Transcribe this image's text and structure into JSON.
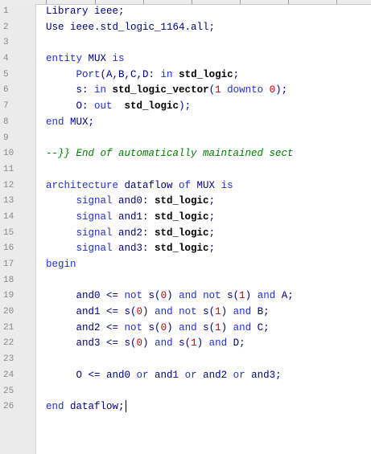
{
  "editor": {
    "lines": [
      {
        "n": "1",
        "tokens": [
          {
            "t": "Library ieee;",
            "c": "id"
          }
        ]
      },
      {
        "n": "2",
        "tokens": [
          {
            "t": "Use ieee.std_logic_1164.all;",
            "c": "id"
          }
        ]
      },
      {
        "n": "3",
        "tokens": []
      },
      {
        "n": "4",
        "tokens": [
          {
            "t": "entity",
            "c": "kw"
          },
          {
            "t": " MUX ",
            "c": "id"
          },
          {
            "t": "is",
            "c": "kw"
          }
        ]
      },
      {
        "n": "5",
        "tokens": [
          {
            "t": "     ",
            "c": "id"
          },
          {
            "t": "Port",
            "c": "kw"
          },
          {
            "t": "(A,B,C,D: ",
            "c": "id"
          },
          {
            "t": "in",
            "c": "kw"
          },
          {
            "t": " ",
            "c": "id"
          },
          {
            "t": "std_logic",
            "c": "ty"
          },
          {
            "t": ";",
            "c": "id"
          }
        ]
      },
      {
        "n": "6",
        "tokens": [
          {
            "t": "     s: ",
            "c": "id"
          },
          {
            "t": "in",
            "c": "kw"
          },
          {
            "t": " ",
            "c": "id"
          },
          {
            "t": "std_logic_vector",
            "c": "ty"
          },
          {
            "t": "(",
            "c": "id"
          },
          {
            "t": "1",
            "c": "num"
          },
          {
            "t": " ",
            "c": "id"
          },
          {
            "t": "downto",
            "c": "kw"
          },
          {
            "t": " ",
            "c": "id"
          },
          {
            "t": "0",
            "c": "num"
          },
          {
            "t": ");",
            "c": "id"
          }
        ]
      },
      {
        "n": "7",
        "tokens": [
          {
            "t": "     O: ",
            "c": "id"
          },
          {
            "t": "out",
            "c": "kw"
          },
          {
            "t": "  ",
            "c": "id"
          },
          {
            "t": "std_logic",
            "c": "ty"
          },
          {
            "t": ");",
            "c": "id"
          }
        ]
      },
      {
        "n": "8",
        "tokens": [
          {
            "t": "end",
            "c": "kw"
          },
          {
            "t": " MUX;",
            "c": "id"
          }
        ]
      },
      {
        "n": "9",
        "tokens": []
      },
      {
        "n": "10",
        "tokens": [
          {
            "t": "--}} End of automatically maintained sect",
            "c": "cm"
          }
        ]
      },
      {
        "n": "11",
        "tokens": []
      },
      {
        "n": "12",
        "tokens": [
          {
            "t": "architecture",
            "c": "kw"
          },
          {
            "t": " dataflow ",
            "c": "id"
          },
          {
            "t": "of",
            "c": "kw"
          },
          {
            "t": " MUX ",
            "c": "id"
          },
          {
            "t": "is",
            "c": "kw"
          }
        ]
      },
      {
        "n": "13",
        "tokens": [
          {
            "t": "     ",
            "c": "id"
          },
          {
            "t": "signal",
            "c": "kw"
          },
          {
            "t": " and0: ",
            "c": "id"
          },
          {
            "t": "std_logic",
            "c": "ty"
          },
          {
            "t": ";",
            "c": "id"
          }
        ]
      },
      {
        "n": "14",
        "tokens": [
          {
            "t": "     ",
            "c": "id"
          },
          {
            "t": "signal",
            "c": "kw"
          },
          {
            "t": " and1: ",
            "c": "id"
          },
          {
            "t": "std_logic",
            "c": "ty"
          },
          {
            "t": ";",
            "c": "id"
          }
        ]
      },
      {
        "n": "15",
        "tokens": [
          {
            "t": "     ",
            "c": "id"
          },
          {
            "t": "signal",
            "c": "kw"
          },
          {
            "t": " and2: ",
            "c": "id"
          },
          {
            "t": "std_logic",
            "c": "ty"
          },
          {
            "t": ";",
            "c": "id"
          }
        ]
      },
      {
        "n": "16",
        "tokens": [
          {
            "t": "     ",
            "c": "id"
          },
          {
            "t": "signal",
            "c": "kw"
          },
          {
            "t": " and3: ",
            "c": "id"
          },
          {
            "t": "std_logic",
            "c": "ty"
          },
          {
            "t": ";",
            "c": "id"
          }
        ]
      },
      {
        "n": "17",
        "tokens": [
          {
            "t": "begin",
            "c": "kw"
          }
        ]
      },
      {
        "n": "18",
        "tokens": []
      },
      {
        "n": "19",
        "tokens": [
          {
            "t": "     and0 <= ",
            "c": "id"
          },
          {
            "t": "not",
            "c": "kw"
          },
          {
            "t": " s(",
            "c": "id"
          },
          {
            "t": "0",
            "c": "num"
          },
          {
            "t": ") ",
            "c": "id"
          },
          {
            "t": "and",
            "c": "kw"
          },
          {
            "t": " ",
            "c": "id"
          },
          {
            "t": "not",
            "c": "kw"
          },
          {
            "t": " s(",
            "c": "id"
          },
          {
            "t": "1",
            "c": "num"
          },
          {
            "t": ") ",
            "c": "id"
          },
          {
            "t": "and",
            "c": "kw"
          },
          {
            "t": " A;",
            "c": "id"
          }
        ]
      },
      {
        "n": "20",
        "tokens": [
          {
            "t": "     and1 <= s(",
            "c": "id"
          },
          {
            "t": "0",
            "c": "num"
          },
          {
            "t": ") ",
            "c": "id"
          },
          {
            "t": "and",
            "c": "kw"
          },
          {
            "t": " ",
            "c": "id"
          },
          {
            "t": "not",
            "c": "kw"
          },
          {
            "t": " s(",
            "c": "id"
          },
          {
            "t": "1",
            "c": "num"
          },
          {
            "t": ") ",
            "c": "id"
          },
          {
            "t": "and",
            "c": "kw"
          },
          {
            "t": " B;",
            "c": "id"
          }
        ]
      },
      {
        "n": "21",
        "tokens": [
          {
            "t": "     and2 <= ",
            "c": "id"
          },
          {
            "t": "not",
            "c": "kw"
          },
          {
            "t": " s(",
            "c": "id"
          },
          {
            "t": "0",
            "c": "num"
          },
          {
            "t": ") ",
            "c": "id"
          },
          {
            "t": "and",
            "c": "kw"
          },
          {
            "t": " s(",
            "c": "id"
          },
          {
            "t": "1",
            "c": "num"
          },
          {
            "t": ") ",
            "c": "id"
          },
          {
            "t": "and",
            "c": "kw"
          },
          {
            "t": " C;",
            "c": "id"
          }
        ]
      },
      {
        "n": "22",
        "tokens": [
          {
            "t": "     and3 <= s(",
            "c": "id"
          },
          {
            "t": "0",
            "c": "num"
          },
          {
            "t": ") ",
            "c": "id"
          },
          {
            "t": "and",
            "c": "kw"
          },
          {
            "t": " s(",
            "c": "id"
          },
          {
            "t": "1",
            "c": "num"
          },
          {
            "t": ") ",
            "c": "id"
          },
          {
            "t": "and",
            "c": "kw"
          },
          {
            "t": " D;",
            "c": "id"
          }
        ]
      },
      {
        "n": "23",
        "tokens": []
      },
      {
        "n": "24",
        "tokens": [
          {
            "t": "     O <= and0 ",
            "c": "id"
          },
          {
            "t": "or",
            "c": "kw"
          },
          {
            "t": " and1 ",
            "c": "id"
          },
          {
            "t": "or",
            "c": "kw"
          },
          {
            "t": " and2 ",
            "c": "id"
          },
          {
            "t": "or",
            "c": "kw"
          },
          {
            "t": " and3;",
            "c": "id"
          }
        ]
      },
      {
        "n": "25",
        "tokens": []
      },
      {
        "n": "26",
        "tokens": [
          {
            "t": "end",
            "c": "kw"
          },
          {
            "t": " dataflow;",
            "c": "id"
          }
        ],
        "caret": true
      }
    ]
  },
  "colors": {
    "keyword": "#1f2fd8",
    "identifier": "#000080",
    "type": "#000000",
    "number": "#c00000",
    "comment": "#008000",
    "gutter": "#ebebeb"
  }
}
